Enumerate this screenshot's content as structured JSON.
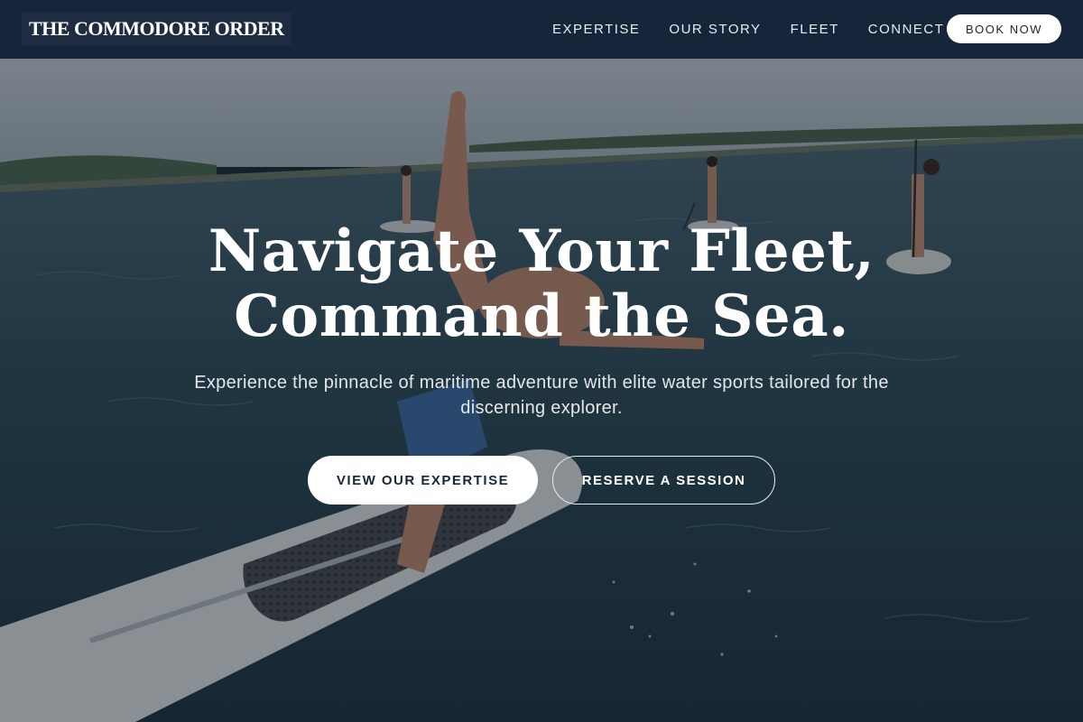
{
  "brand": {
    "name": "THE COMMODORE ORDER"
  },
  "nav": {
    "items": [
      {
        "label": "EXPERTISE"
      },
      {
        "label": "OUR STORY"
      },
      {
        "label": "FLEET"
      },
      {
        "label": "CONNECT"
      }
    ],
    "cta_label": "BOOK NOW"
  },
  "hero": {
    "title_line1": "Navigate Your Fleet,",
    "title_line2": "Command the Sea.",
    "subtitle": "Experience the pinnacle of maritime adventure with elite water sports tailored for the discerning explorer.",
    "primary_cta": "VIEW OUR EXPERTISE",
    "secondary_cta": "RESERVE A SESSION"
  },
  "colors": {
    "nav_bg": "#17253a",
    "accent_text": "#1b2637",
    "water": "#1f3a44"
  }
}
